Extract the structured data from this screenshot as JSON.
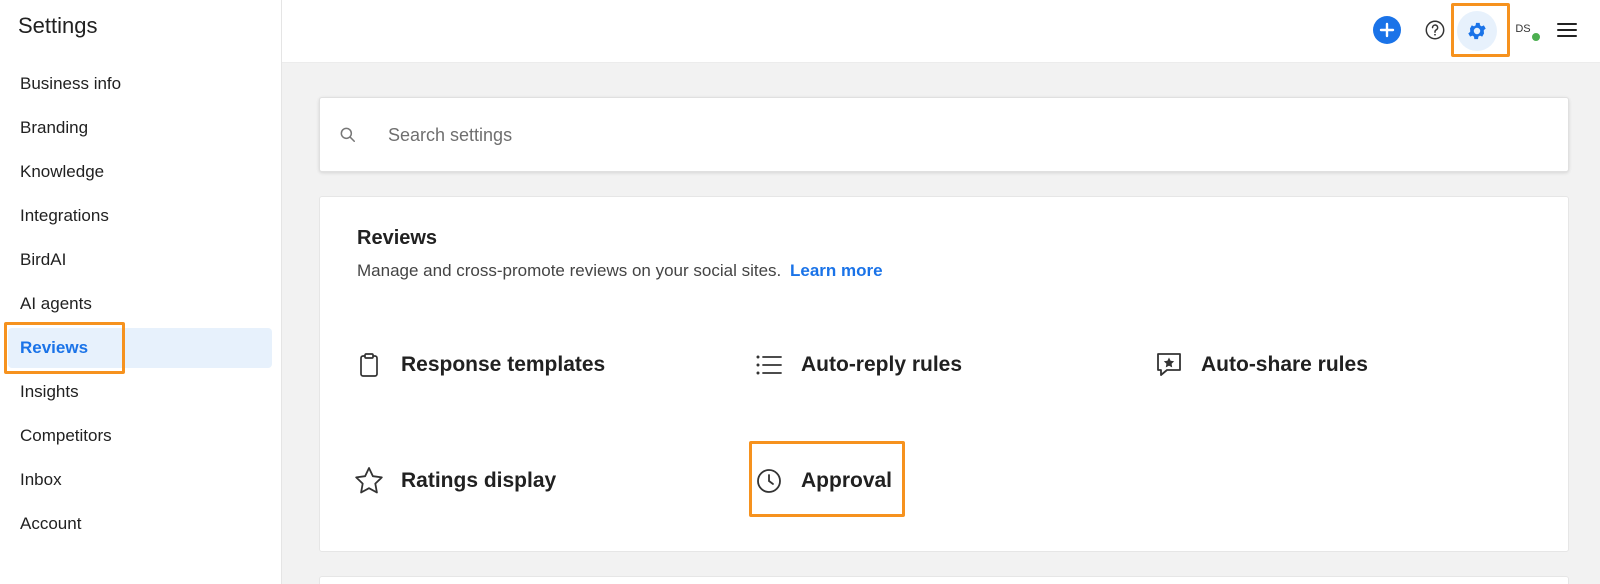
{
  "sidebar": {
    "title": "Settings",
    "items": [
      {
        "label": "Business info"
      },
      {
        "label": "Branding"
      },
      {
        "label": "Knowledge"
      },
      {
        "label": "Integrations"
      },
      {
        "label": "BirdAI"
      },
      {
        "label": "AI agents"
      },
      {
        "label": "Reviews",
        "active": true
      },
      {
        "label": "Insights"
      },
      {
        "label": "Competitors"
      },
      {
        "label": "Inbox"
      },
      {
        "label": "Account"
      }
    ]
  },
  "topbar": {
    "avatar_initials": "DS",
    "icons": [
      "add-icon",
      "help-icon",
      "gear-icon",
      "menu-icon"
    ]
  },
  "search": {
    "placeholder": "Search settings",
    "value": ""
  },
  "reviews_card": {
    "title": "Reviews",
    "description": "Manage and cross-promote reviews on your social sites.",
    "learn_more": "Learn more",
    "tiles": [
      {
        "label": "Response templates",
        "icon": "clipboard-icon"
      },
      {
        "label": "Auto-reply rules",
        "icon": "list-icon"
      },
      {
        "label": "Auto-share rules",
        "icon": "star-chat-icon"
      },
      {
        "label": "Ratings display",
        "icon": "star-icon"
      },
      {
        "label": "Approval",
        "icon": "clock-icon"
      }
    ]
  },
  "colors": {
    "accent": "#1a73e8",
    "active_bg": "#e7f1fc",
    "highlight": "#f6921e",
    "presence": "#4caf50"
  }
}
